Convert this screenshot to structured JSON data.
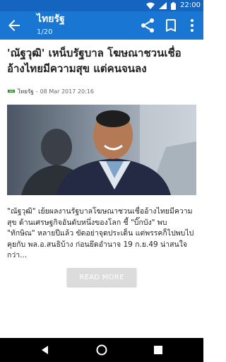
{
  "status_bar": {
    "time": "22:00",
    "icons": [
      "wifi-icon",
      "signal-icon",
      "battery-icon"
    ]
  },
  "app_bar": {
    "title": "ไทยรัฐ",
    "subtitle": "1/20",
    "icons": [
      "back-arrow-icon",
      "share-icon",
      "bookmark-icon",
      "more-vert-icon"
    ]
  },
  "article": {
    "headline": "'ณัฐวุฒิ' เหน็บรัฐบาล โฆษณาชวนเชื่ออ้างไทยมีความสุข แต่คนจนลง",
    "source": "ไทยรัฐ",
    "separator": "-",
    "date": "08 Mar 2017 20:16",
    "body": "\"ณัฐวุฒิ\" เย้ยผลงานรัฐบาลโฆษณาชวนเชื่ออ้างไทยมีความสุข ด้านเศรษฐกิจอันดับหนึ่งของโลก ชี้ \"บิ๊กบัง\" พบ \"ทักษิณ\" หลายปีแล้ว ขัดอย่าจุดประเด็น แต่พรรคก็ไปพบไปคุยกับ พล.อ.สนธิบ้าง ก่อนยึดอำนาจ 19 ก.ย.49 น่าสนใจกว่า...",
    "read_more_label": "READ MORE"
  },
  "colors": {
    "status_bar": "#1565c0",
    "app_bar": "#1976d2",
    "read_more_bg": "#dcdcdc"
  }
}
